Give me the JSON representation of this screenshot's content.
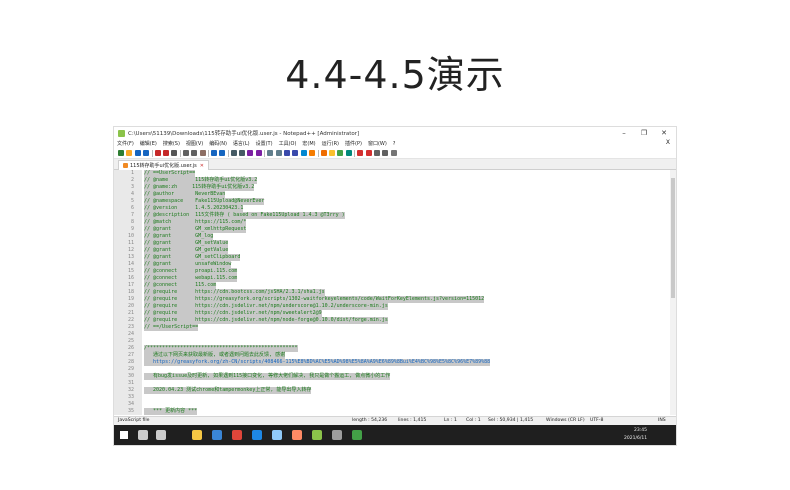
{
  "slide": {
    "title": "4.4-4.5演示"
  },
  "window": {
    "title": "C:\\Users\\51139\\Downloads\\115转存助手ui优化版.user.js - Notepad++ [Administrator]",
    "controls": [
      "–",
      "❐",
      "✕"
    ]
  },
  "menu": {
    "items": [
      "文件(F)",
      "编辑(E)",
      "搜索(S)",
      "视图(V)",
      "编码(N)",
      "语言(L)",
      "设置(T)",
      "工具(O)",
      "宏(M)",
      "运行(R)",
      "插件(P)",
      "窗口(W)",
      "?"
    ],
    "close": "X"
  },
  "toolbar": {
    "buttons": [
      "new-icon",
      "open-icon",
      "save-icon",
      "save-all-icon",
      "close-icon",
      "close-all-icon",
      "print-icon",
      "cut-icon",
      "copy-icon",
      "paste-icon",
      "undo-icon",
      "redo-icon",
      "find-icon",
      "replace-icon",
      "zoom-in-icon",
      "zoom-out-icon",
      "sync-v-icon",
      "sync-h-icon",
      "wrap-icon",
      "all-chars-icon",
      "indent-guide-icon",
      "lang-icon",
      "doc-map-icon",
      "function-list-icon",
      "folder-icon",
      "monitor-icon",
      "record-icon",
      "stop-icon",
      "play-icon",
      "play-multi-icon",
      "save-macro-icon"
    ],
    "colors": [
      "#2e7d32",
      "#f9a825",
      "#1565c0",
      "#1565c0",
      "#c62828",
      "#c62828",
      "#555555",
      "#616161",
      "#616161",
      "#8d6e63",
      "#1565c0",
      "#1565c0",
      "#455a64",
      "#455a64",
      "#7b1fa2",
      "#7b1fa2",
      "#607d8b",
      "#607d8b",
      "#3949ab",
      "#3949ab",
      "#0288d1",
      "#f57c00",
      "#ef6c00",
      "#fbc02d",
      "#43a047",
      "#00897b",
      "#d32f2f",
      "#d32f2f",
      "#616161",
      "#616161",
      "#757575"
    ]
  },
  "tab": {
    "label": "115转存助手ui优化版.user.js"
  },
  "editor": {
    "lines": [
      {
        "n": "1",
        "text": "// ==UserScript==",
        "sel": true
      },
      {
        "n": "2",
        "text": "// @name         115转存助手ui优化版v3.2",
        "sel": true
      },
      {
        "n": "3",
        "text": "// @name:zh     115转存助手ui优化版v3.2",
        "sel": true
      },
      {
        "n": "4",
        "text": "// @author       NeverBEvan",
        "sel": true
      },
      {
        "n": "5",
        "text": "// @namespace    Fake115Upload@NeverEver",
        "sel": true
      },
      {
        "n": "6",
        "text": "// @version      1.4.5.20230423.1",
        "sel": true
      },
      {
        "n": "7",
        "text": "// @description  115文件转存 ( based on Fake115Upload 1.4.3 @T3rry )",
        "sel": true
      },
      {
        "n": "8",
        "text": "// @match        https://115.com/*",
        "sel": true
      },
      {
        "n": "9",
        "text": "// @grant        GM_xmlhttpRequest",
        "sel": true
      },
      {
        "n": "10",
        "text": "// @grant        GM_log",
        "sel": true
      },
      {
        "n": "11",
        "text": "// @grant        GM_setValue",
        "sel": true
      },
      {
        "n": "12",
        "text": "// @grant        GM_getValue",
        "sel": true
      },
      {
        "n": "13",
        "text": "// @grant        GM_setClipboard",
        "sel": true
      },
      {
        "n": "14",
        "text": "// @grant        unsafeWindow",
        "sel": true
      },
      {
        "n": "15",
        "text": "// @connect      proapi.115.com",
        "sel": true
      },
      {
        "n": "16",
        "text": "// @connect      webapi.115.com",
        "sel": true
      },
      {
        "n": "17",
        "text": "// @connect      115.com",
        "sel": true
      },
      {
        "n": "18",
        "text": "// @require      https://cdn.bootcss.com/jsSHA/2.3.1/sha1.js",
        "sel": true
      },
      {
        "n": "19",
        "text": "// @require      https://greasyfork.org/scripts/1302-waitforkeyelements/code/WaitForKeyElements.js?version=115012",
        "sel": true
      },
      {
        "n": "20",
        "text": "// @require      https://cdn.jsdelivr.net/npm/underscore@1.10.2/underscore-min.js",
        "sel": true
      },
      {
        "n": "21",
        "text": "// @require      https://cdn.jsdelivr.net/npm/sweetalert2@9",
        "sel": true
      },
      {
        "n": "22",
        "text": "// @require      https://cdn.jsdelivr.net/npm/node-forge@0.10.0/dist/forge.min.js",
        "sel": true
      },
      {
        "n": "23",
        "text": "// ==/UserScript==",
        "sel": true
      },
      {
        "n": "24",
        "text": "",
        "sel": false
      },
      {
        "n": "25",
        "text": "",
        "sel": false
      },
      {
        "n": "26",
        "text": "/**************************************************",
        "sel": true
      },
      {
        "n": "27",
        "text": "   通过以下网页来获取最新版, 或者遇到问题去此反馈, 感谢",
        "sel": true
      },
      {
        "n": "28",
        "text": "   https://greasyfork.org/zh-CN/scripts/408466-115%E8%BD%AC%E5%AD%98%E5%8A%A9%E6%89%8Bui%E4%BC%98%E5%8C%96%E7%89%88",
        "sel": true
      },
      {
        "n": "29",
        "text": "",
        "sel": false
      },
      {
        "n": "30",
        "text": "   有bug发issue及时更新, 如果遇到115接口变化, 等修大佬们解决, 我只是做个搬运工, 做点微小的工作",
        "sel": true
      },
      {
        "n": "31",
        "text": "",
        "sel": false
      },
      {
        "n": "32",
        "text": "   2020.04.23 测试chrome和tampermonkey上正常, 能导出导入转存",
        "sel": true
      },
      {
        "n": "33",
        "text": "",
        "sel": false
      },
      {
        "n": "34",
        "text": "",
        "sel": false
      },
      {
        "n": "35",
        "text": "   *** 更新内容 ***",
        "sel": true
      }
    ]
  },
  "status": {
    "filetype": "JavaScript file",
    "length": "length : 54,236",
    "lines": "lines : 1,415",
    "ln": "Ln : 1",
    "col": "Col : 1",
    "sel": "Sel : 50,934 | 1,415",
    "eol": "Windows (CR LF)",
    "enc": "UTF-8",
    "ins": "INS"
  },
  "taskbar": {
    "time": "23:45",
    "date": "2021/6/11",
    "apps": [
      "windows-start-icon",
      "search-icon",
      "task-view-icon",
      "file-explorer-icon",
      "edge-icon",
      "chrome-icon",
      "store-icon",
      "mail-icon",
      "media-player-icon",
      "notepadpp-icon",
      "terminal-icon",
      "wechat-icon"
    ],
    "app_colors": [
      "#ffffff",
      "#cccccc",
      "#cccccc",
      "#f6c744",
      "#3a86d6",
      "#e0463a",
      "#1e88e5",
      "#90caf9",
      "#ff8a65",
      "#8bc34a",
      "#9e9e9e",
      "#43a047"
    ]
  }
}
